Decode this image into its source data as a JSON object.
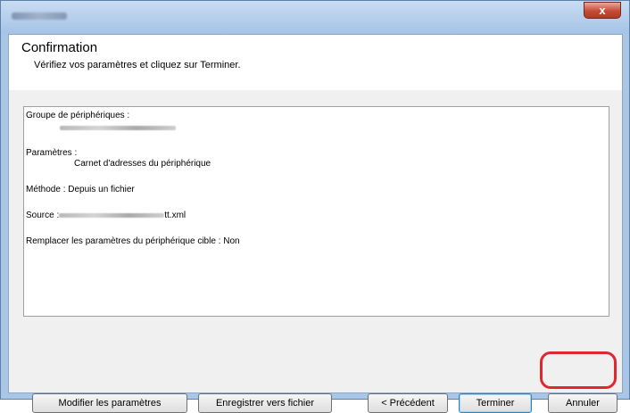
{
  "window": {
    "close_glyph": "x"
  },
  "header": {
    "title": "Confirmation",
    "subtitle": "Vérifiez vos paramètres et cliquez sur Terminer."
  },
  "summary": {
    "device_group_label": "Groupe de périphériques :",
    "settings_label": "Paramètres :",
    "settings_value": "Carnet d'adresses du périphérique",
    "method_line": "Méthode : Depuis un fichier",
    "source_label": "Source :",
    "source_suffix": "tt.xml",
    "replace_line": "Remplacer les paramètres du périphérique cible : Non"
  },
  "buttons": {
    "modify": "Modifier les paramètres",
    "save": "Enregistrer vers fichier",
    "previous": "< Précédent",
    "finish": "Terminer",
    "cancel": "Annuler"
  },
  "colors": {
    "highlight": "#e0272f",
    "window_frame": "#a9c6e6",
    "close_button": "#c74a35"
  }
}
